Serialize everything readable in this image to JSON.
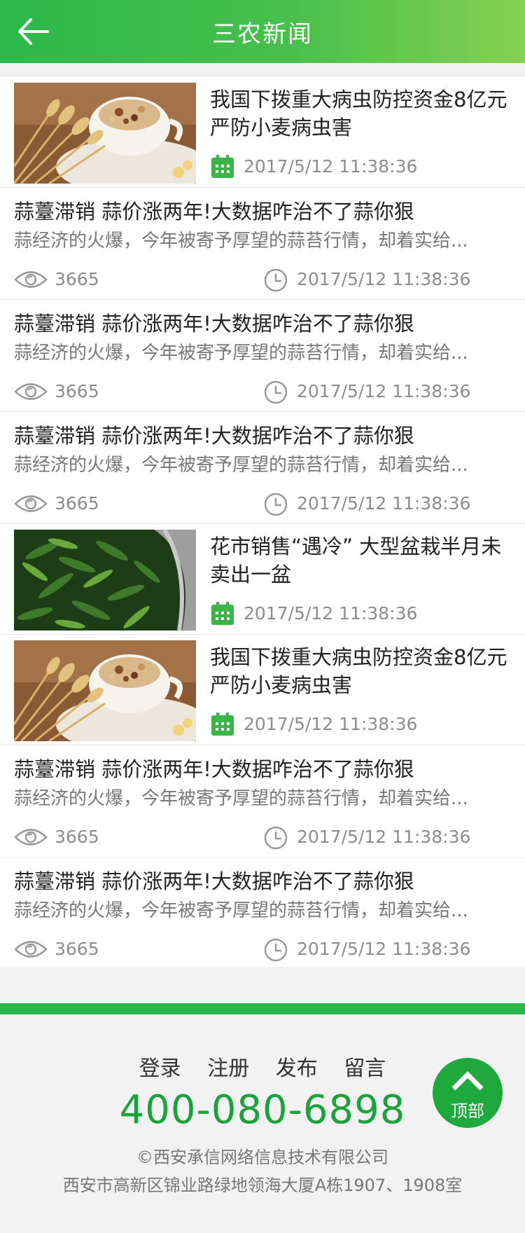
{
  "header": {
    "title": "三农新闻",
    "back_icon": "arrow-left-icon"
  },
  "colors": {
    "accent": "#2bb84a",
    "phone": "#19a33a",
    "calendar": "#3ab54a"
  },
  "news": [
    {
      "type": "image",
      "title": "我国下拨重大病虫防控资金8亿元 严防小麦病虫害",
      "date": "2017/5/12 11:38:36",
      "thumb": "wheat-cup-image"
    },
    {
      "type": "text",
      "title": "蒜薹滞销 蒜价涨两年!大数据咋治不了蒜你狠",
      "desc": "蒜经济的火爆，今年被寄予厚望的蒜苔行情，却着实给...",
      "views": "3665",
      "date": "2017/5/12 11:38:36"
    },
    {
      "type": "text",
      "title": "蒜薹滞销 蒜价涨两年!大数据咋治不了蒜你狠",
      "desc": "蒜经济的火爆，今年被寄予厚望的蒜苔行情，却着实给...",
      "views": "3665",
      "date": "2017/5/12 11:38:36"
    },
    {
      "type": "text",
      "title": "蒜薹滞销 蒜价涨两年!大数据咋治不了蒜你狠",
      "desc": "蒜经济的火爆，今年被寄予厚望的蒜苔行情，却着实给...",
      "views": "3665",
      "date": "2017/5/12 11:38:36"
    },
    {
      "type": "image",
      "title": "花市销售“遇冷” 大型盆栽半月未卖出一盆",
      "date": "2017/5/12 11:38:36",
      "thumb": "bamboo-plant-image"
    },
    {
      "type": "image",
      "title": "我国下拨重大病虫防控资金8亿元 严防小麦病虫害",
      "date": "2017/5/12 11:38:36",
      "thumb": "wheat-cup-image"
    },
    {
      "type": "text",
      "title": "蒜薹滞销 蒜价涨两年!大数据咋治不了蒜你狠",
      "desc": "蒜经济的火爆，今年被寄予厚望的蒜苔行情，却着实给...",
      "views": "3665",
      "date": "2017/5/12 11:38:36"
    },
    {
      "type": "text",
      "title": "蒜薹滞销 蒜价涨两年!大数据咋治不了蒜你狠",
      "desc": "蒜经济的火爆，今年被寄予厚望的蒜苔行情，却着实给...",
      "views": "3665",
      "date": "2017/5/12 11:38:36"
    }
  ],
  "footer": {
    "links": [
      "登录",
      "注册",
      "发布",
      "留言"
    ],
    "phone": "400-080-6898",
    "copyright": "©西安承信网络信息技术有限公司",
    "address": "西安市高新区锦业路绿地领海大厦A栋1907、1908室"
  },
  "back_to_top": {
    "label": "顶部",
    "icon": "chevron-up-icon"
  }
}
